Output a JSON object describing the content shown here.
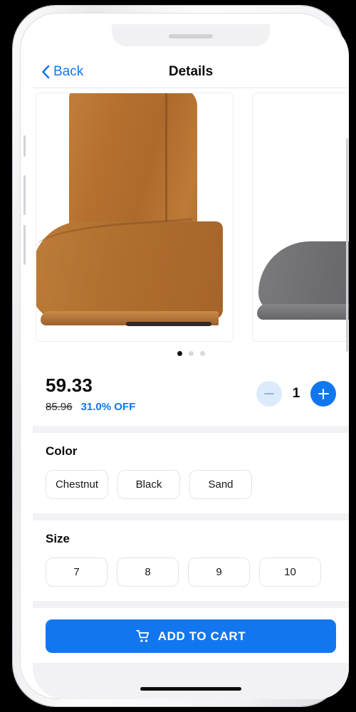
{
  "nav": {
    "back_label": "Back",
    "title": "Details",
    "back_icon": "chevron-left-icon",
    "accent_color": "#1176ef"
  },
  "gallery": {
    "images": [
      {
        "alt": "Chestnut suede boot",
        "color": "#b5702f",
        "active": true
      },
      {
        "alt": "Grey suede boot",
        "color": "#6b6b6e",
        "active": false
      }
    ],
    "dots": [
      {
        "active": true
      },
      {
        "active": false
      },
      {
        "active": false
      }
    ]
  },
  "price": {
    "current": "59.33",
    "original": "85.96",
    "discount": "31.0% OFF",
    "discount_color": "#1176ef"
  },
  "quantity": {
    "value": "1",
    "decrease_icon": "minus-icon",
    "increase_icon": "plus-icon",
    "decrease_enabled": false,
    "increase_enabled": true
  },
  "color": {
    "title": "Color",
    "options": [
      "Chestnut",
      "Black",
      "Sand"
    ]
  },
  "size": {
    "title": "Size",
    "options": [
      "7",
      "8",
      "9",
      "10"
    ]
  },
  "cart": {
    "label": "ADD TO CART",
    "icon": "shopping-cart-icon",
    "background": "#1277ef"
  }
}
